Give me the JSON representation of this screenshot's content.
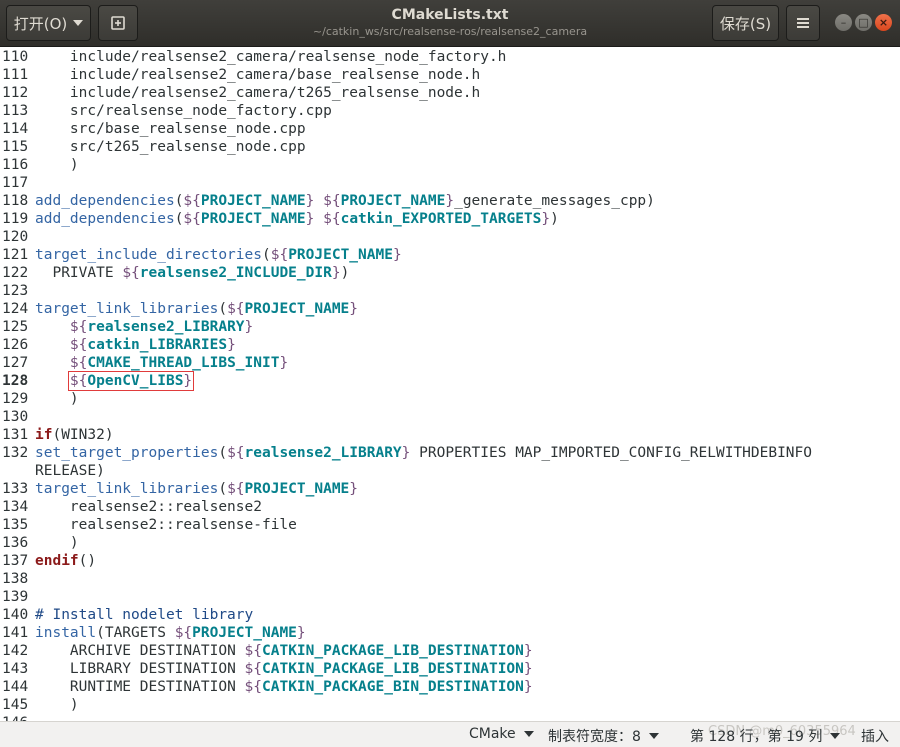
{
  "header": {
    "open_label": "打开(O)",
    "title": "CMakeLists.txt",
    "subtitle": "~/catkin_ws/src/realsense-ros/realsense2_camera",
    "save_label": "保存(S)"
  },
  "editor": {
    "current_line": "128",
    "highlighted_token": "${OpenCV_LIBS}",
    "lines": [
      {
        "n": "110",
        "t": "    include/realsense2_camera/realsense_node_factory.h"
      },
      {
        "n": "111",
        "t": "    include/realsense2_camera/base_realsense_node.h"
      },
      {
        "n": "112",
        "t": "    include/realsense2_camera/t265_realsense_node.h"
      },
      {
        "n": "113",
        "t": "    src/realsense_node_factory.cpp"
      },
      {
        "n": "114",
        "t": "    src/base_realsense_node.cpp"
      },
      {
        "n": "115",
        "t": "    src/t265_realsense_node.cpp"
      },
      {
        "n": "116",
        "t": "    )"
      },
      {
        "n": "117",
        "t": ""
      },
      {
        "n": "118",
        "t": "add_dependencies(${PROJECT_NAME} ${PROJECT_NAME}_generate_messages_cpp)"
      },
      {
        "n": "119",
        "t": "add_dependencies(${PROJECT_NAME} ${catkin_EXPORTED_TARGETS})"
      },
      {
        "n": "120",
        "t": ""
      },
      {
        "n": "121",
        "t": "target_include_directories(${PROJECT_NAME}"
      },
      {
        "n": "122",
        "t": "  PRIVATE ${realsense2_INCLUDE_DIR})"
      },
      {
        "n": "123",
        "t": ""
      },
      {
        "n": "124",
        "t": "target_link_libraries(${PROJECT_NAME}"
      },
      {
        "n": "125",
        "t": "    ${realsense2_LIBRARY}"
      },
      {
        "n": "126",
        "t": "    ${catkin_LIBRARIES}"
      },
      {
        "n": "127",
        "t": "    ${CMAKE_THREAD_LIBS_INIT}"
      },
      {
        "n": "128",
        "t": "    ${OpenCV_LIBS}"
      },
      {
        "n": "129",
        "t": "    )"
      },
      {
        "n": "130",
        "t": ""
      },
      {
        "n": "131",
        "t": "if(WIN32)"
      },
      {
        "n": "132",
        "t": "set_target_properties(${realsense2_LIBRARY} PROPERTIES MAP_IMPORTED_CONFIG_RELWITHDEBINFO"
      },
      {
        "n": "",
        "t": "RELEASE)"
      },
      {
        "n": "133",
        "t": "target_link_libraries(${PROJECT_NAME}"
      },
      {
        "n": "134",
        "t": "    realsense2::realsense2"
      },
      {
        "n": "135",
        "t": "    realsense2::realsense-file"
      },
      {
        "n": "136",
        "t": "    )"
      },
      {
        "n": "137",
        "t": "endif()"
      },
      {
        "n": "138",
        "t": ""
      },
      {
        "n": "139",
        "t": ""
      },
      {
        "n": "140",
        "t": "# Install nodelet library"
      },
      {
        "n": "141",
        "t": "install(TARGETS ${PROJECT_NAME}"
      },
      {
        "n": "142",
        "t": "    ARCHIVE DESTINATION ${CATKIN_PACKAGE_LIB_DESTINATION}"
      },
      {
        "n": "143",
        "t": "    LIBRARY DESTINATION ${CATKIN_PACKAGE_LIB_DESTINATION}"
      },
      {
        "n": "144",
        "t": "    RUNTIME DESTINATION ${CATKIN_PACKAGE_BIN_DESTINATION}"
      },
      {
        "n": "145",
        "t": "    )"
      },
      {
        "n": "146",
        "t": ""
      }
    ]
  },
  "statusbar": {
    "language": "CMake",
    "tab_width": "制表符宽度：8",
    "position": "第 128 行，第 19 列",
    "insert_mode": "插入",
    "watermark": "CSDN @m0_60355964"
  },
  "icons": {
    "open_caret": "chevron-down-icon",
    "new_tab": "new-document-icon",
    "menu": "hamburger-menu-icon",
    "minimize": "minimize-icon",
    "maximize": "maximize-icon",
    "close": "close-icon"
  },
  "colors": {
    "header_bg": "#3c3b37",
    "function": "#3465a4",
    "variable": "#06808c",
    "keyword": "#8b1a1a",
    "highlight_box": "#e03b3b"
  }
}
